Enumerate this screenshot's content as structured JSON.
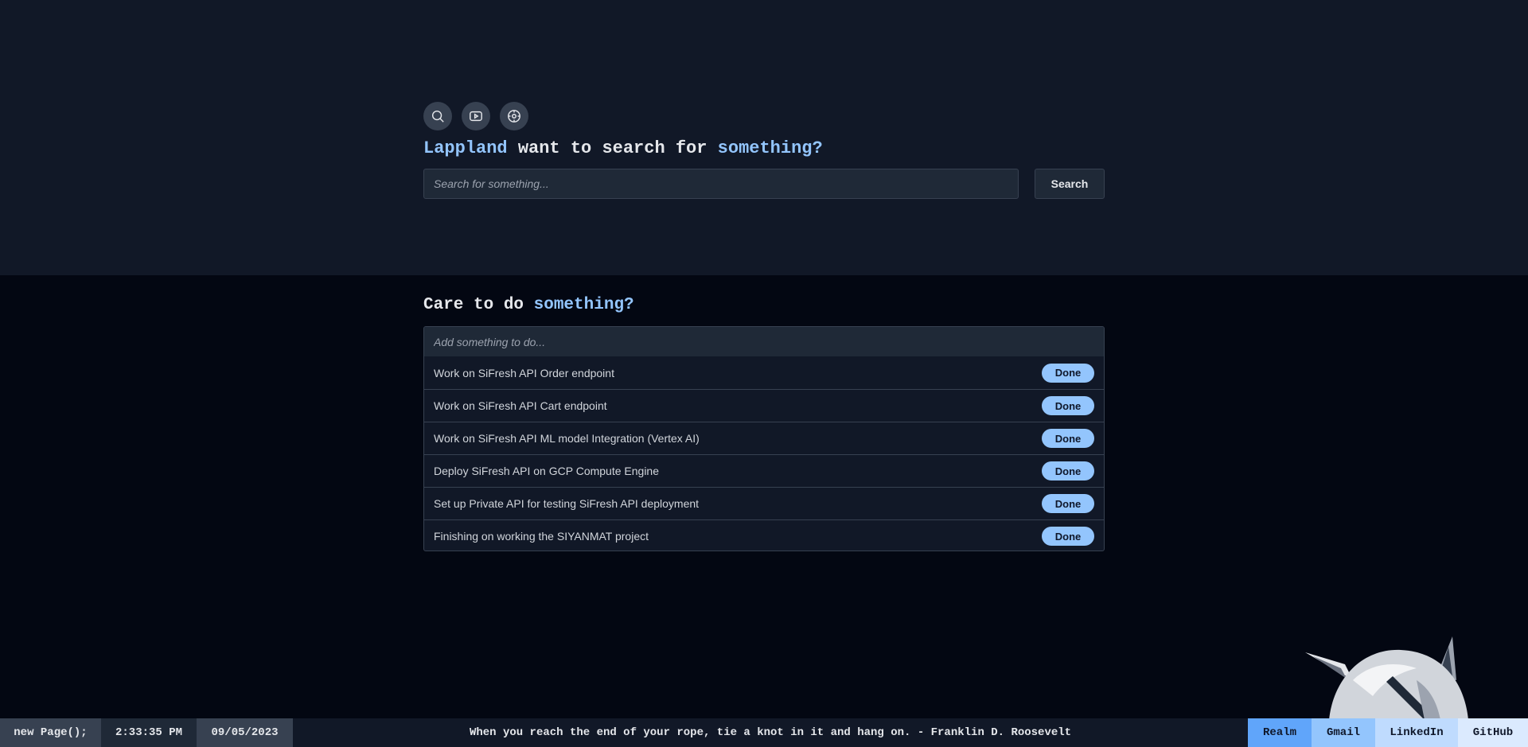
{
  "engines": [
    {
      "icon": "search-icon"
    },
    {
      "icon": "youtube-icon"
    },
    {
      "icon": "compass-icon"
    }
  ],
  "headline": {
    "name": "Lappland",
    "middle": " want to search for ",
    "accent": "something?"
  },
  "search": {
    "placeholder": "Search for something...",
    "button_label": "Search"
  },
  "todo": {
    "title_prefix": "Care to do ",
    "title_accent": "something?",
    "input_placeholder": "Add something to do...",
    "done_label": "Done",
    "items": [
      "Work on SiFresh API Order endpoint",
      "Work on SiFresh API Cart endpoint",
      "Work on SiFresh API ML model Integration (Vertex AI)",
      "Deploy SiFresh API on GCP Compute Engine",
      "Set up Private API for testing SiFresh API deployment",
      "Finishing on working the SIYANMAT project"
    ]
  },
  "statusbar": {
    "page": "new Page();",
    "time": "2:33:35 PM",
    "date": "09/05/2023",
    "quote": "When you reach the end of your rope, tie a knot in it and hang on. - Franklin D. Roosevelt",
    "links": [
      "Realm",
      "Gmail",
      "LinkedIn",
      "GitHub"
    ]
  },
  "colors": {
    "accent": "#93c5fd",
    "top_bg": "#111827",
    "page_bg": "#030712"
  }
}
